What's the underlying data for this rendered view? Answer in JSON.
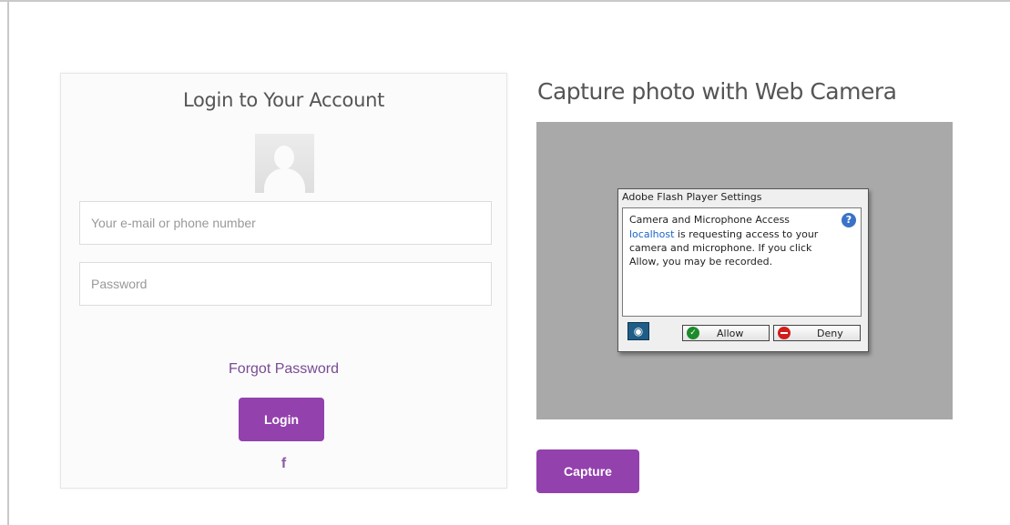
{
  "login": {
    "title": "Login to Your Account",
    "email_placeholder": "Your e-mail or phone number",
    "password_placeholder": "Password",
    "forgot_label": "Forgot Password",
    "login_label": "Login",
    "facebook_glyph": "f"
  },
  "camera": {
    "title": "Capture photo with Web Camera",
    "capture_label": "Capture",
    "flash_dialog": {
      "title": "Adobe Flash Player Settings",
      "heading": "Camera and Microphone Access",
      "link_text": "localhost",
      "message": " is requesting access to your camera and microphone. If you click Allow, you may be recorded.",
      "help_glyph": "?",
      "allow_label": "Allow",
      "deny_label": "Deny"
    }
  },
  "colors": {
    "accent": "#9341ad",
    "link": "#7a4b93",
    "camera_bg": "#a9a9a9"
  },
  "icons": [
    "user-avatar-icon",
    "facebook-icon",
    "help-icon",
    "webcam-icon",
    "allow-check-icon",
    "deny-icon"
  ]
}
